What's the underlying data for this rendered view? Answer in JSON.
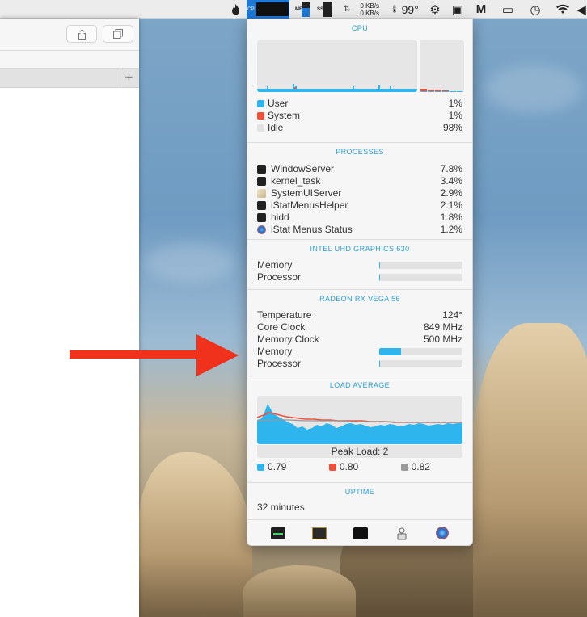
{
  "menubar": {
    "cpu_label": "CPU",
    "mem_label": "MEM",
    "ssd_label": "SSD",
    "net_up": "0 KB/s",
    "net_down": "0 KB/s",
    "sensor_value": "99°"
  },
  "cpu": {
    "title": "CPU",
    "rows": [
      {
        "label": "User",
        "value": "1%",
        "color": "#2fb5ee"
      },
      {
        "label": "System",
        "value": "1%",
        "color": "#f0503a"
      },
      {
        "label": "Idle",
        "value": "98%",
        "color": "#e2e2e2"
      }
    ]
  },
  "processes": {
    "title": "PROCESSES",
    "items": [
      {
        "name": "WindowServer",
        "value": "7.8%"
      },
      {
        "name": "kernel_task",
        "value": "3.4%"
      },
      {
        "name": "SystemUIServer",
        "value": "2.9%"
      },
      {
        "name": "iStatMenusHelper",
        "value": "2.1%"
      },
      {
        "name": "hidd",
        "value": "1.8%"
      },
      {
        "name": "iStat Menus Status",
        "value": "1.2%"
      }
    ]
  },
  "intel_gpu": {
    "title": "INTEL UHD GRAPHICS 630",
    "memory_label": "Memory",
    "memory_fraction": 0.01,
    "processor_label": "Processor",
    "processor_fraction": 0.01
  },
  "radeon_gpu": {
    "title": "RADEON RX VEGA 56",
    "temp_label": "Temperature",
    "temp_value": "124°",
    "core_label": "Core Clock",
    "core_value": "849 MHz",
    "memclock_label": "Memory Clock",
    "memclock_value": "500 MHz",
    "memory_label": "Memory",
    "memory_fraction": 0.26,
    "processor_label": "Processor",
    "processor_fraction": 0.01
  },
  "load_average": {
    "title": "LOAD AVERAGE",
    "peak_label": "Peak Load: 2",
    "values": [
      {
        "value": "0.79",
        "color": "#2fb5ee"
      },
      {
        "value": "0.80",
        "color": "#f0503a"
      },
      {
        "value": "0.82",
        "color": "#999999"
      }
    ]
  },
  "uptime": {
    "title": "UPTIME",
    "value": "32 minutes"
  },
  "footer_icons": [
    "activity-monitor-icon",
    "console-icon",
    "terminal-icon",
    "system-utility-icon",
    "istat-icon"
  ]
}
